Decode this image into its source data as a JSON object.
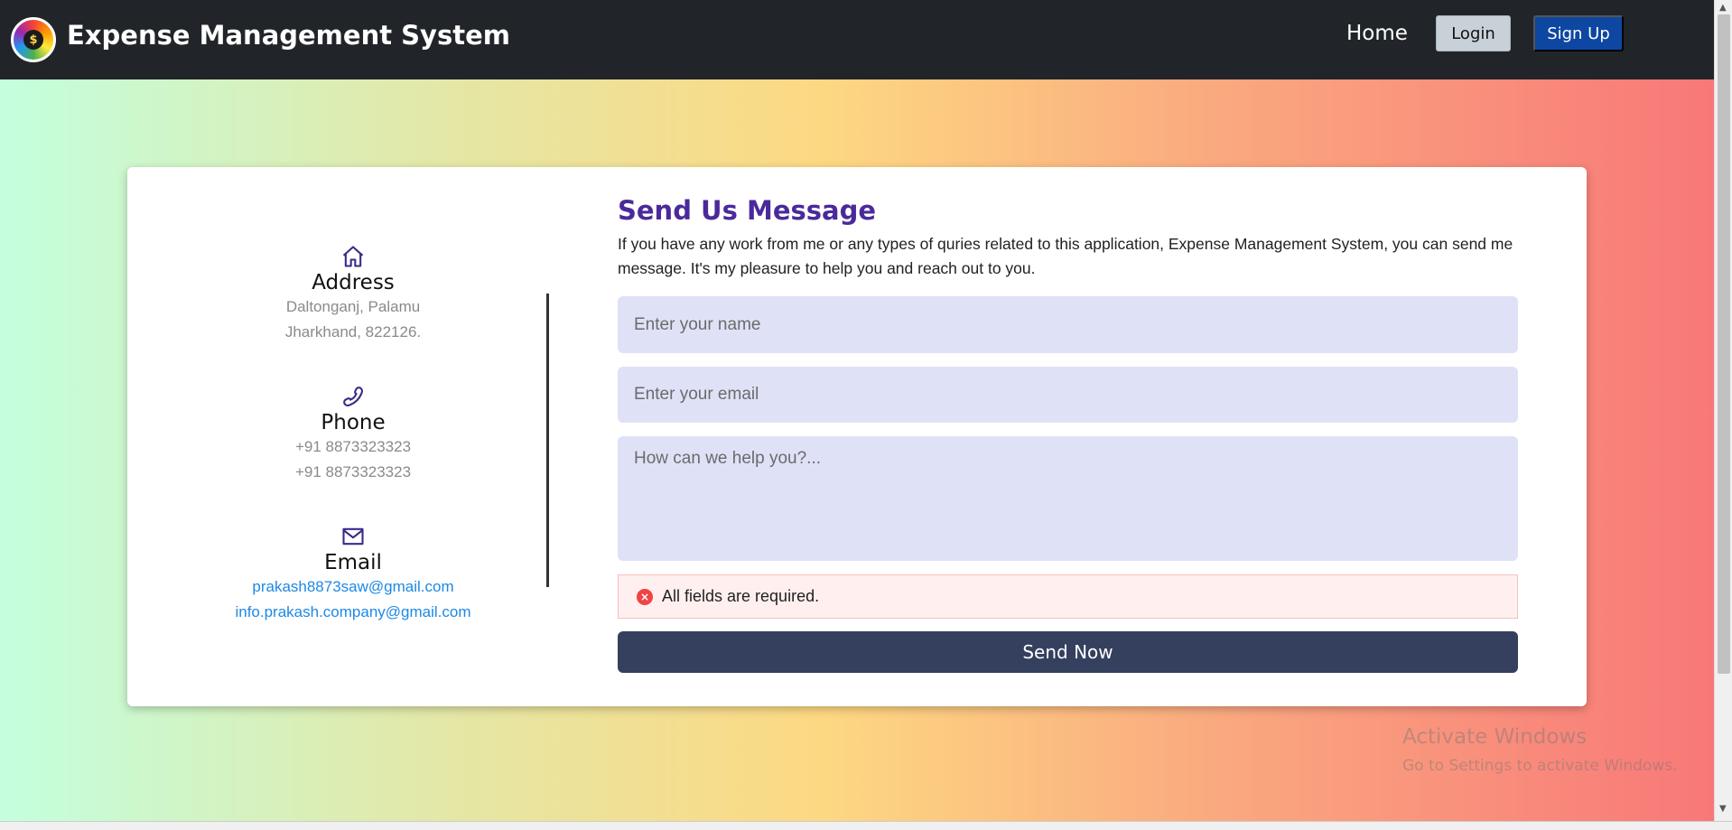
{
  "navbar": {
    "brand": "Expense Management System",
    "logo_glyph": "$",
    "home": "Home",
    "login": "Login",
    "signup": "Sign Up"
  },
  "contact_info": {
    "address": {
      "icon": "home-icon",
      "title": "Address",
      "line1": "Daltonganj, Palamu",
      "line2": "Jharkhand, 822126."
    },
    "phone": {
      "icon": "phone-icon",
      "title": "Phone",
      "line1": "+91 8873323323",
      "line2": "+91 8873323323"
    },
    "email": {
      "icon": "mail-icon",
      "title": "Email",
      "line1": "prakash8873saw@gmail.com",
      "line2": "info.prakash.company@gmail.com"
    }
  },
  "form": {
    "title": "Send Us Message",
    "description": "If you have any work from me or any types of quries related to this application, Expense Management System, you can send me message. It's my pleasure to help you and reach out to you.",
    "name_placeholder": "Enter your name",
    "name_value": "",
    "email_placeholder": "Enter your email",
    "email_value": "",
    "message_placeholder": "How can we help you?...",
    "message_value": "",
    "error_icon": "×",
    "error": "All fields are required.",
    "submit": "Send Now"
  },
  "watermark": {
    "title": "Activate Windows",
    "subtitle": "Go to Settings to activate Windows."
  },
  "colors": {
    "navbar": "#212529",
    "accent_title": "#4a2a9a",
    "signup_button": "#0d47a1",
    "send_button": "#34405e",
    "input_bg": "#dfe2f7",
    "link": "#1e88e5",
    "error": "#ef4444"
  }
}
